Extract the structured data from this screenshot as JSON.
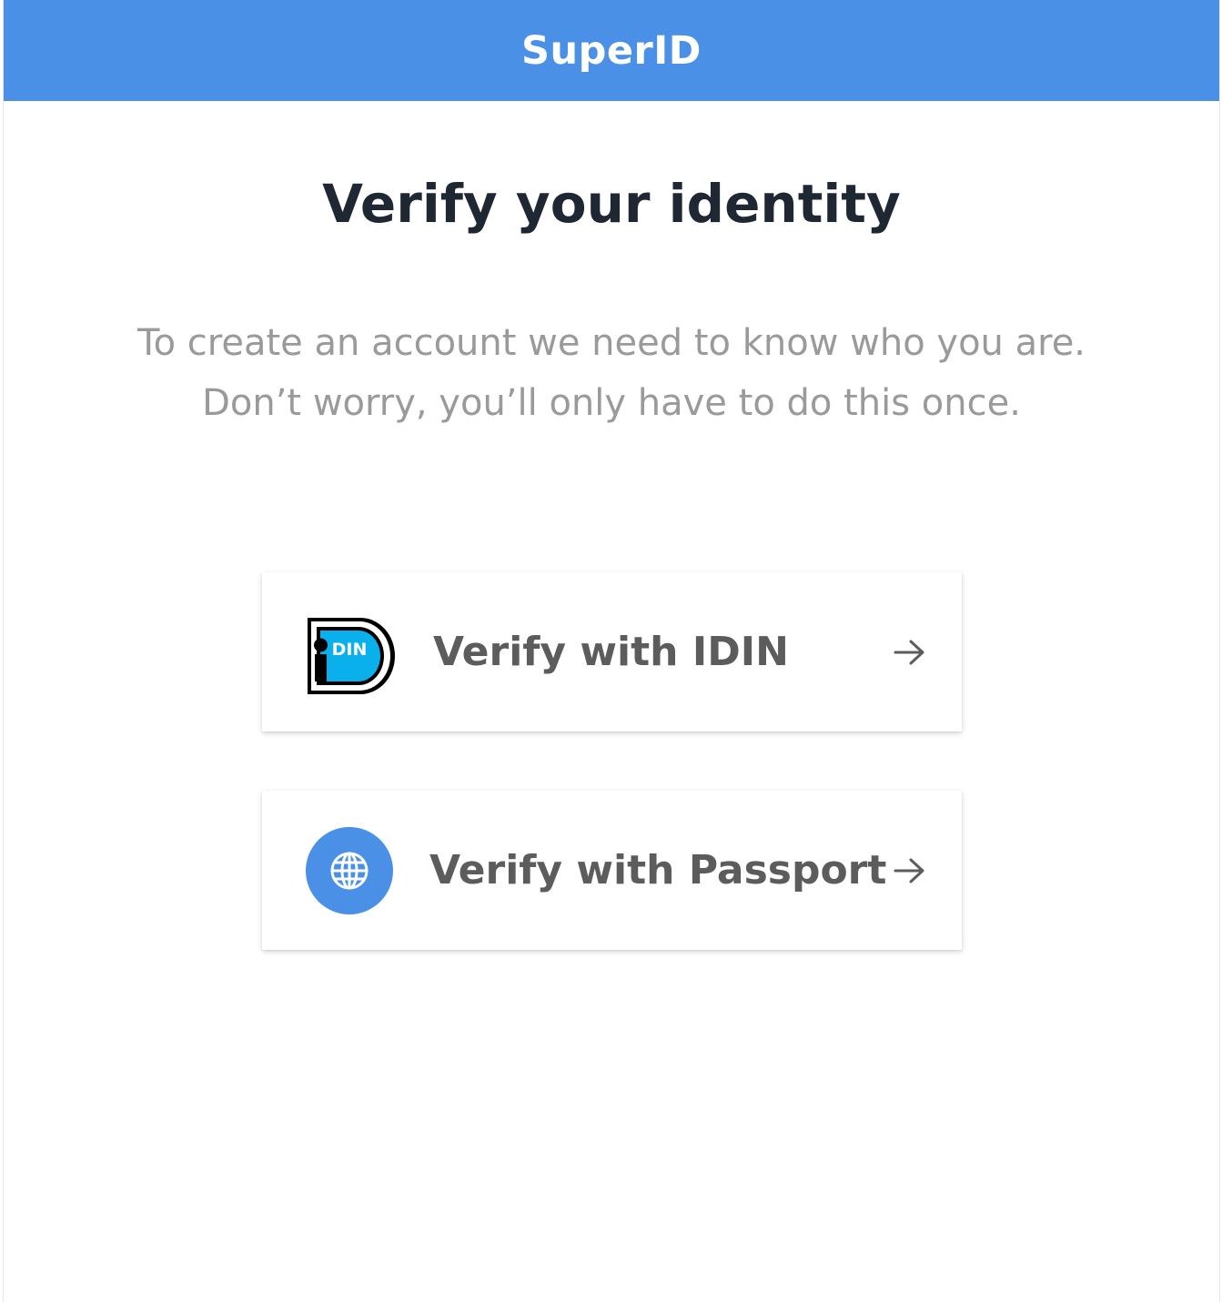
{
  "colors": {
    "brand": "#4a90e6",
    "title_text": "#1f2733",
    "body_text": "#9a9a9a",
    "button_text": "#5c5c5c",
    "idin_blue": "#0ab0ec"
  },
  "header": {
    "title": "SuperID"
  },
  "main": {
    "title": "Verify your identity",
    "intro_line_1": "To create an account we need to know who you are.",
    "intro_line_2": "Don’t worry, you’ll only have to do this once."
  },
  "options": {
    "idin": {
      "label": "Verify with IDIN",
      "icon": "idin-logo",
      "logo_text": "DIN",
      "arrow": "arrow-right-icon"
    },
    "passport": {
      "label": "Verify with Passport",
      "icon": "globe-icon",
      "arrow": "arrow-right-icon"
    }
  }
}
